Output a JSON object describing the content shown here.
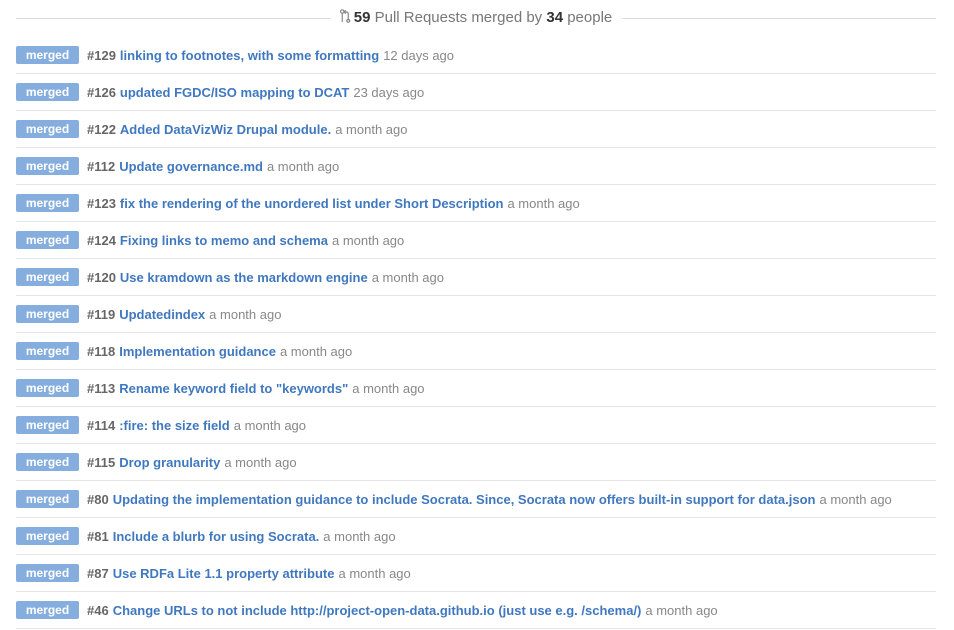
{
  "summary": {
    "pr_count": "59",
    "middle_text": " Pull Requests merged by ",
    "people_count": "34",
    "end_text": " people"
  },
  "pull_requests": [
    {
      "badge": "merged",
      "number": "#129",
      "title": "linking to footnotes, with some formatting",
      "time": "12 days ago"
    },
    {
      "badge": "merged",
      "number": "#126",
      "title": "updated FGDC/ISO mapping to DCAT",
      "time": "23 days ago"
    },
    {
      "badge": "merged",
      "number": "#122",
      "title": "Added DataVizWiz Drupal module.",
      "time": "a month ago"
    },
    {
      "badge": "merged",
      "number": "#112",
      "title": "Update governance.md",
      "time": "a month ago"
    },
    {
      "badge": "merged",
      "number": "#123",
      "title": "fix the rendering of the unordered list under Short Description",
      "time": "a month ago"
    },
    {
      "badge": "merged",
      "number": "#124",
      "title": "Fixing links to memo and schema",
      "time": "a month ago"
    },
    {
      "badge": "merged",
      "number": "#120",
      "title": "Use kramdown as the markdown engine",
      "time": "a month ago"
    },
    {
      "badge": "merged",
      "number": "#119",
      "title": "Updatedindex",
      "time": "a month ago"
    },
    {
      "badge": "merged",
      "number": "#118",
      "title": "Implementation guidance",
      "time": "a month ago"
    },
    {
      "badge": "merged",
      "number": "#113",
      "title": "Rename keyword field to \"keywords\"",
      "time": "a month ago"
    },
    {
      "badge": "merged",
      "number": "#114",
      "title": ":fire: the size field",
      "time": "a month ago"
    },
    {
      "badge": "merged",
      "number": "#115",
      "title": "Drop granularity",
      "time": "a month ago"
    },
    {
      "badge": "merged",
      "number": "#80",
      "title": "Updating the implementation guidance to include Socrata. Since, Socrata now offers built-in support for data.json",
      "time": "a month ago"
    },
    {
      "badge": "merged",
      "number": "#81",
      "title": "Include a blurb for using Socrata.",
      "time": "a month ago"
    },
    {
      "badge": "merged",
      "number": "#87",
      "title": "Use RDFa Lite 1.1 property attribute",
      "time": "a month ago"
    },
    {
      "badge": "merged",
      "number": "#46",
      "title": "Change URLs to not include http://project-open-data.github.io (just use e.g. /schema/)",
      "time": "a month ago"
    }
  ],
  "icons": {
    "summary": "pull-request-icon"
  },
  "colors": {
    "badge_bg": "#85aede",
    "link": "#4078c0",
    "number": "#666666",
    "time": "#888888"
  }
}
